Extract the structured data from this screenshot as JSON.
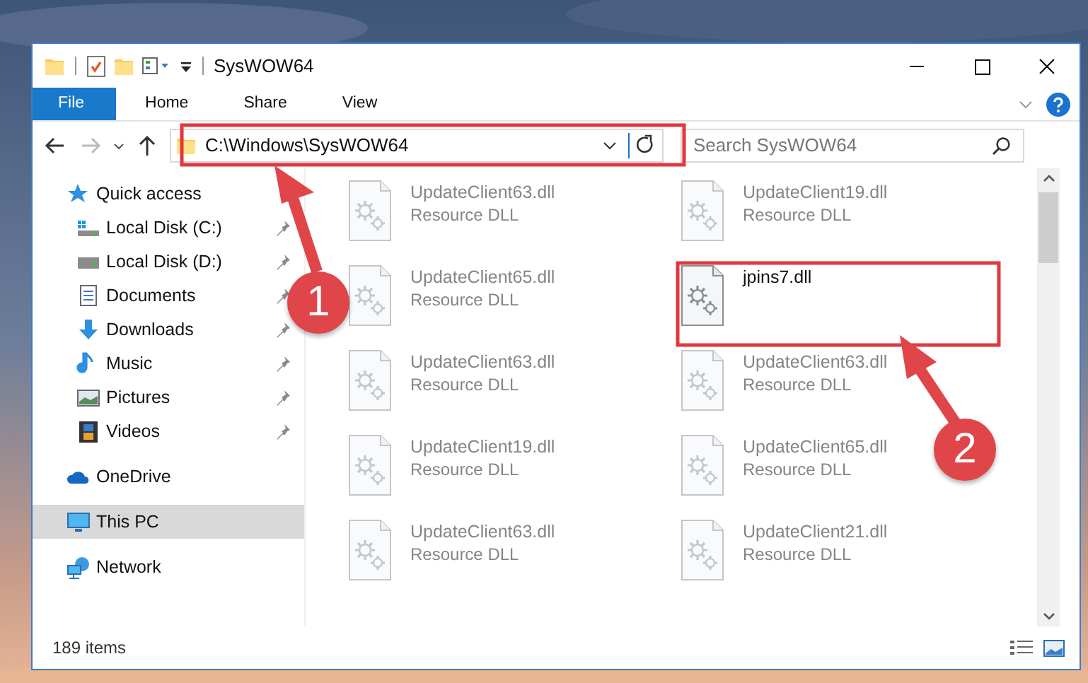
{
  "window": {
    "title": "SysWOW64"
  },
  "ribbon_tabs": [
    {
      "label": "File",
      "selected": true
    },
    {
      "label": "Home",
      "selected": false
    },
    {
      "label": "Share",
      "selected": false
    },
    {
      "label": "View",
      "selected": false
    }
  ],
  "address": {
    "path": "C:\\Windows\\SysWOW64"
  },
  "search": {
    "placeholder": "Search SysWOW64"
  },
  "sidebar": {
    "items": [
      {
        "label": "Quick access",
        "kind": "star",
        "selected": false,
        "children": [
          {
            "label": "Local Disk (C:)",
            "kind": "drive-windows",
            "pinned": true,
            "selected": false
          },
          {
            "label": "Local Disk (D:)",
            "kind": "drive",
            "pinned": true,
            "selected": false
          },
          {
            "label": "Documents",
            "kind": "documents",
            "pinned": true,
            "selected": false
          },
          {
            "label": "Downloads",
            "kind": "downloads",
            "pinned": true,
            "selected": false
          },
          {
            "label": "Music",
            "kind": "music",
            "pinned": true,
            "selected": false
          },
          {
            "label": "Pictures",
            "kind": "pictures",
            "pinned": true,
            "selected": false
          },
          {
            "label": "Videos",
            "kind": "videos",
            "pinned": true,
            "selected": false
          }
        ]
      },
      {
        "label": "OneDrive",
        "kind": "cloud",
        "selected": false
      },
      {
        "label": "This PC",
        "kind": "pc",
        "selected": true
      },
      {
        "label": "Network",
        "kind": "network",
        "selected": false
      }
    ]
  },
  "files": [
    {
      "name": "UpdateClient63.dll",
      "type": "Resource DLL",
      "blurred": true
    },
    {
      "name": "UpdateClient19.dll",
      "type": "Resource DLL",
      "blurred": true
    },
    {
      "name": "UpdateClient65.dll",
      "type": "Resource DLL",
      "blurred": true
    },
    {
      "name": "jpins7.dll",
      "blurred": false
    },
    {
      "name": "UpdateClient63.dll",
      "type": "Resource DLL",
      "blurred": true
    },
    {
      "name": "UpdateClient63.dll",
      "type": "Resource DLL",
      "blurred": true
    },
    {
      "name": "UpdateClient19.dll",
      "type": "Resource DLL",
      "blurred": true
    },
    {
      "name": "UpdateClient65.dll",
      "type": "Resource DLL",
      "blurred": true
    },
    {
      "name": "UpdateClient63.dll",
      "type": "Resource DLL",
      "blurred": true
    },
    {
      "name": "UpdateClient21.dll",
      "type": "Resource DLL",
      "blurred": true
    }
  ],
  "status_bar": {
    "item_count": "189 items"
  },
  "annotations": [
    {
      "label": "1"
    },
    {
      "label": "2"
    }
  ]
}
